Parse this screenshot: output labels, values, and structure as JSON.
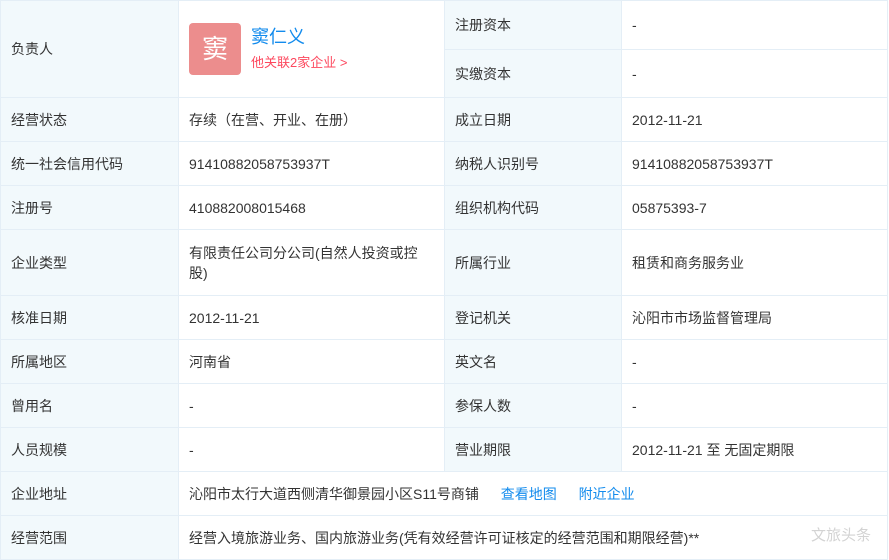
{
  "rows": [
    {
      "label": "负责人"
    },
    {
      "label": "注册资本",
      "value": "-"
    },
    {
      "label": "实缴资本",
      "value": "-"
    },
    {
      "label": "经营状态",
      "value": "存续（在营、开业、在册）"
    },
    {
      "label": "成立日期",
      "value": "2012-11-21"
    },
    {
      "label": "统一社会信用代码",
      "value": "91410882058753937T"
    },
    {
      "label": "纳税人识别号",
      "value": "91410882058753937T"
    },
    {
      "label": "注册号",
      "value": "410882008015468"
    },
    {
      "label": "组织机构代码",
      "value": "05875393-7"
    },
    {
      "label": "企业类型",
      "value": "有限责任公司分公司(自然人投资或控股)"
    },
    {
      "label": "所属行业",
      "value": "租赁和商务服务业"
    },
    {
      "label": "核准日期",
      "value": "2012-11-21"
    },
    {
      "label": "登记机关",
      "value": "沁阳市市场监督管理局"
    },
    {
      "label": "所属地区",
      "value": "河南省"
    },
    {
      "label": "英文名",
      "value": "-"
    },
    {
      "label": "曾用名",
      "value": "-"
    },
    {
      "label": "参保人数",
      "value": "-"
    },
    {
      "label": "人员规模",
      "value": "-"
    },
    {
      "label": "营业期限",
      "value": "2012-11-21 至 无固定期限"
    },
    {
      "label": "企业地址",
      "value": "沁阳市太行大道西侧清华御景园小区S11号商铺"
    },
    {
      "label": "经营范围",
      "value": "经营入境旅游业务、国内旅游业务(凭有效经营许可证核定的经营范围和期限经营)**"
    }
  ],
  "person": {
    "avatar_char": "窦",
    "name": "窦仁义",
    "link": "他关联2家企业 >"
  },
  "address_links": {
    "map": "查看地图",
    "nearby": "附近企业"
  },
  "watermark": "文旅头条"
}
